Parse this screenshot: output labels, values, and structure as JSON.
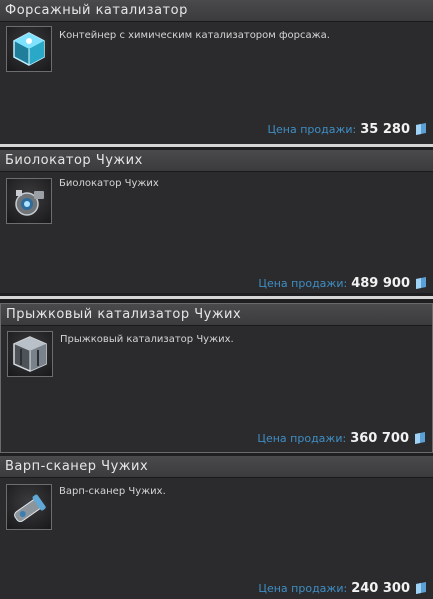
{
  "price_label": "Цена продажи:",
  "items": [
    {
      "title": "Форсажный катализатор",
      "description": "Контейнер с химическим катализатором форсажа.",
      "price": "35 280",
      "icon": "catalyst-container-icon"
    },
    {
      "title": "Биолокатор Чужих",
      "description": "Биолокатор Чужих",
      "price": "489 900",
      "icon": "biolocator-icon"
    },
    {
      "title": "Прыжковый катализатор Чужих",
      "description": "Прыжковый катализатор Чужих.",
      "price": "360 700",
      "icon": "jump-catalyst-icon"
    },
    {
      "title": "Варп-сканер Чужих",
      "description": "Варп-сканер Чужих.",
      "price": "240 300",
      "icon": "warp-scanner-icon"
    }
  ],
  "colors": {
    "background": "#1f1f21",
    "card": "#2b2b2d",
    "header": "#404042",
    "price_label": "#3f8ec4",
    "divider": "#d6d6d6"
  }
}
